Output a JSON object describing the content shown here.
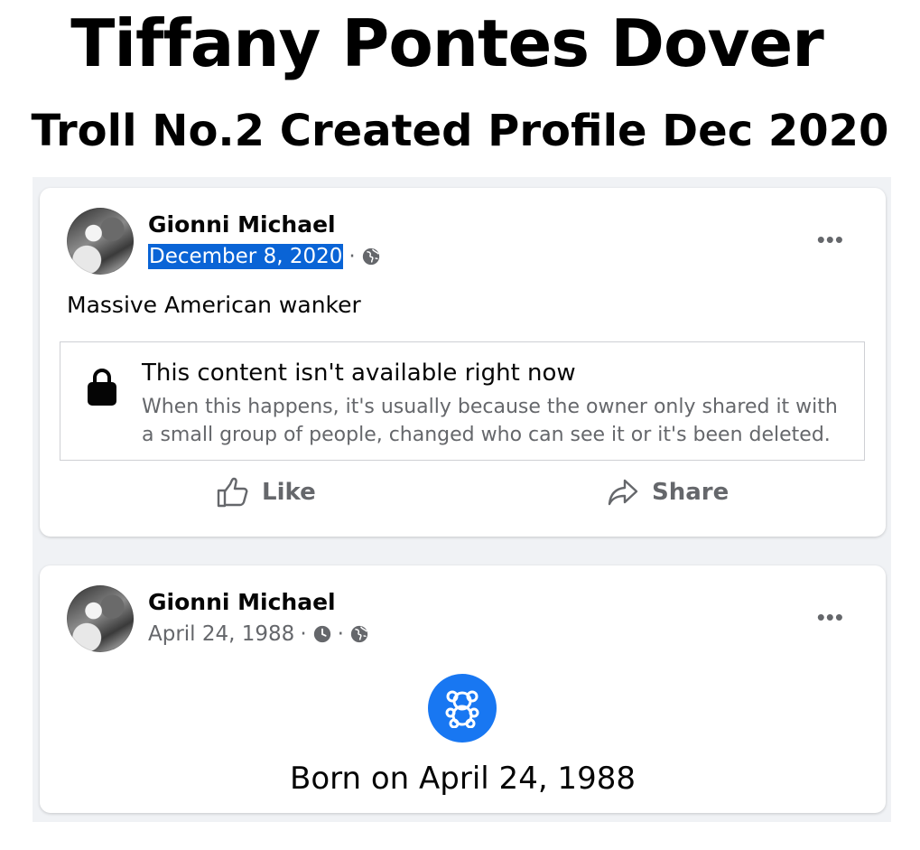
{
  "header": {
    "title": "Tiffany Pontes Dover",
    "subtitle": "Troll No.2 Created Profile Dec 2020"
  },
  "posts": [
    {
      "author": "Gionni Michael",
      "date": "December 8, 2020",
      "separator": "·",
      "audience_icon": "globe-icon",
      "text": "Massive American wanker",
      "unavailable_title": "This content isn't available right now",
      "unavailable_body": "When this happens, it's usually because the owner only shared it with a small group of people, changed who can see it or it's been deleted.",
      "like_label": "Like",
      "share_label": "Share",
      "more_label": "•••"
    },
    {
      "author": "Gionni Michael",
      "date": "April 24, 1988",
      "separator": "·",
      "clock_icon": "clock-icon",
      "audience_icon": "globe-icon",
      "life_event_icon": "teddy-bear-icon",
      "life_event_text": "Born on April 24, 1988",
      "more_label": "•••"
    }
  ],
  "colors": {
    "feed_background": "#f0f2f5",
    "accent_blue": "#1877f2",
    "selection_blue": "#0a64d6",
    "secondary_text": "#65676b"
  }
}
